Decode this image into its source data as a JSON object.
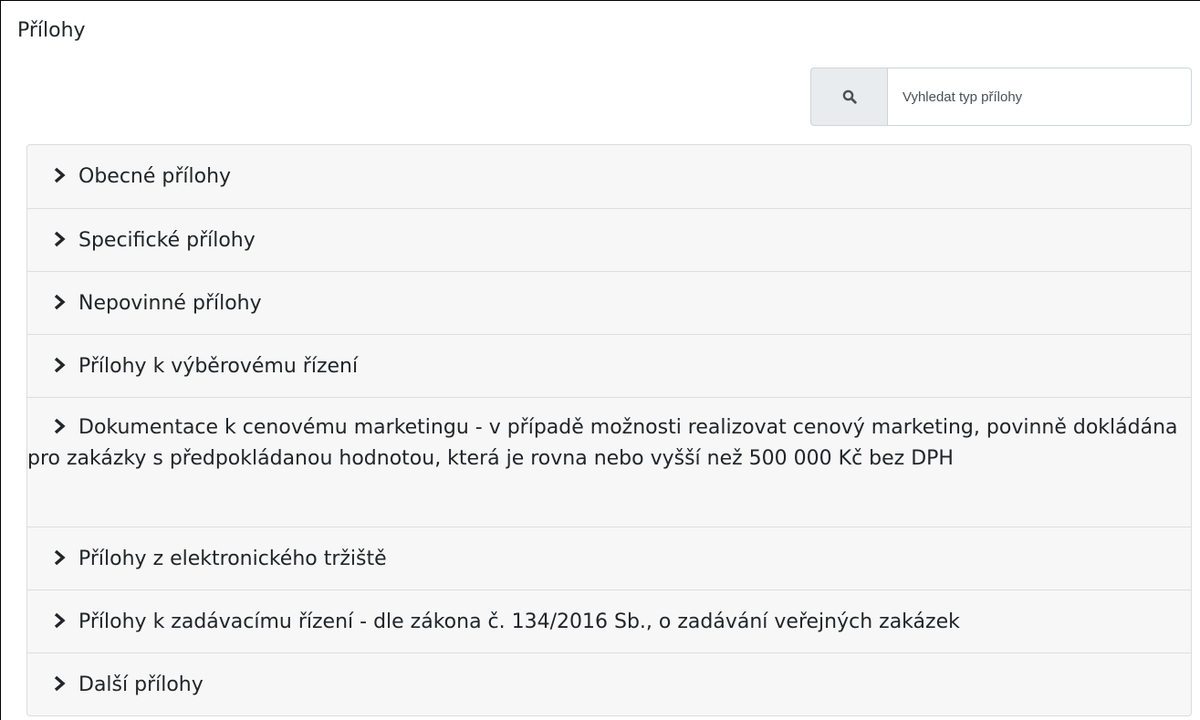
{
  "section": {
    "title": "Přílohy"
  },
  "search": {
    "icon": "search-icon",
    "placeholder": "Vyhledat typ přílohy",
    "value": ""
  },
  "accordion": {
    "chevron_icon": "chevron-right-icon",
    "items": [
      {
        "label": "Obecné přílohy"
      },
      {
        "label": "Specifické přílohy"
      },
      {
        "label": "Nepovinné přílohy"
      },
      {
        "label": "Přílohy k výběrovému řízení"
      },
      {
        "label": "Dokumentace k cenovému marketingu - v případě možnosti realizovat cenový marketing, povinně dokládána pro zakázky s předpokládanou hodnotou, která je rovna nebo vyšší než 500 000 Kč bez DPH"
      },
      {
        "label": "Přílohy z elektronického tržiště"
      },
      {
        "label": "Přílohy k zadávacímu řízení - dle zákona č. 134/2016 Sb., o zadávání veřejných zakázek"
      },
      {
        "label": "Další přílohy"
      }
    ]
  },
  "colors": {
    "accordion_header_bg": "#f7f7f7",
    "search_addon_bg": "#e9ecef",
    "border": "#ced4da",
    "text": "#212529"
  }
}
